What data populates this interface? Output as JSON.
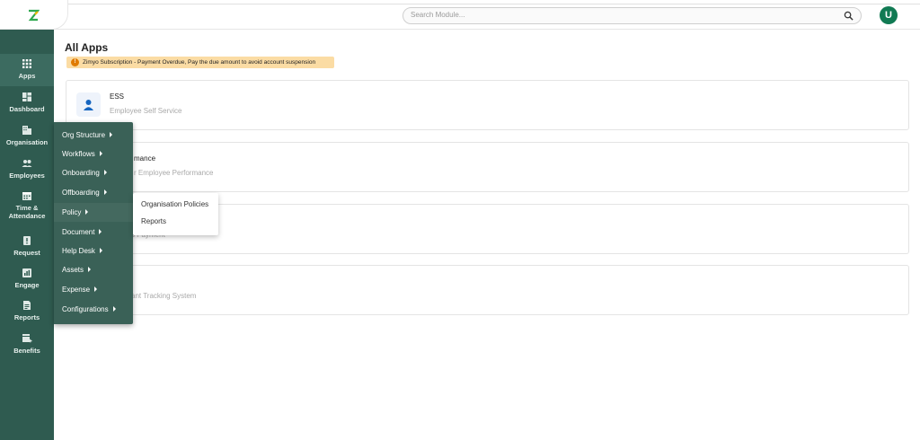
{
  "header": {
    "search_placeholder": "Search Module...",
    "avatar_initial": "U"
  },
  "sidebar": {
    "items": [
      {
        "label": "Apps",
        "icon": "grid-icon"
      },
      {
        "label": "Dashboard",
        "icon": "dashboard-icon"
      },
      {
        "label": "Organisation",
        "icon": "building-icon"
      },
      {
        "label": "Employees",
        "icon": "people-icon"
      },
      {
        "label": "Time &",
        "label2": "Attendance",
        "icon": "calendar-icon"
      },
      {
        "label": "Request",
        "icon": "request-icon"
      },
      {
        "label": "Engage",
        "icon": "engage-icon"
      },
      {
        "label": "Reports",
        "icon": "report-icon"
      },
      {
        "label": "Benefits",
        "icon": "benefits-icon"
      }
    ]
  },
  "main": {
    "title": "All Apps",
    "alert": "Zimyo Subscription - Payment Overdue, Pay the due amount to avoid account suspension",
    "cards": [
      {
        "title": "ESS",
        "subtitle": "Employee Self Service"
      },
      {
        "title": "mance",
        "subtitle": "r Employee Performance"
      },
      {
        "title": "",
        "subtitle": "s Payment"
      },
      {
        "title": "",
        "subtitle": "ant Tracking System"
      }
    ]
  },
  "menu": {
    "items": [
      {
        "label": "Org Structure"
      },
      {
        "label": "Workflows"
      },
      {
        "label": "Onboarding"
      },
      {
        "label": "Offboarding"
      },
      {
        "label": "Policy"
      },
      {
        "label": "Document"
      },
      {
        "label": "Help Desk"
      },
      {
        "label": "Assets"
      },
      {
        "label": "Expense"
      },
      {
        "label": "Configurations"
      }
    ],
    "submenu": [
      {
        "label": "Organisation Policies"
      },
      {
        "label": "Reports"
      }
    ]
  },
  "colors": {
    "sidebar": "#2f5b50",
    "menu": "#3a6157",
    "alert_bg": "#fbdca4",
    "avatar": "#117a53"
  }
}
